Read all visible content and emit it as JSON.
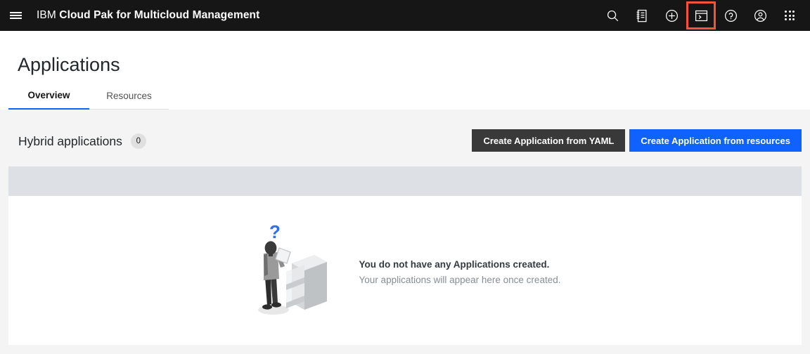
{
  "header": {
    "menu_icon": "hamburger-menu-icon",
    "brand_prefix": "IBM",
    "brand_name": "Cloud Pak for Multicloud Management",
    "actions": [
      {
        "name": "search-icon",
        "label": "Search"
      },
      {
        "name": "catalog-icon",
        "label": "Catalog"
      },
      {
        "name": "plus-circle-icon",
        "label": "Create resource"
      },
      {
        "name": "terminal-icon",
        "label": "Terminal",
        "highlighted": true
      },
      {
        "name": "help-icon",
        "label": "Help"
      },
      {
        "name": "user-avatar-icon",
        "label": "User profile"
      },
      {
        "name": "app-switcher-icon",
        "label": "Switcher"
      }
    ],
    "background_color": "#161616",
    "highlight_color": "#f4543c"
  },
  "annotation": {
    "arrow_color": "#f4543c",
    "points_to": "terminal-icon"
  },
  "page": {
    "title": "Applications",
    "tabs": [
      {
        "label": "Overview",
        "active": true
      },
      {
        "label": "Resources",
        "active": false
      }
    ],
    "accent_color": "#0f62fe"
  },
  "section": {
    "title": "Hybrid applications",
    "count": "0",
    "buttons": [
      {
        "label": "Create Application from YAML",
        "style": "secondary",
        "color": "#393939"
      },
      {
        "label": "Create Application from resources",
        "style": "primary",
        "color": "#0f62fe"
      }
    ]
  },
  "table": {
    "header_color": "#dde1e6",
    "columns": []
  },
  "empty_state": {
    "illustration": "person-with-filing-cabinet-illustration",
    "question_mark": "?",
    "title": "You do not have any Applications created.",
    "subtitle": "Your applications will appear here once created."
  }
}
